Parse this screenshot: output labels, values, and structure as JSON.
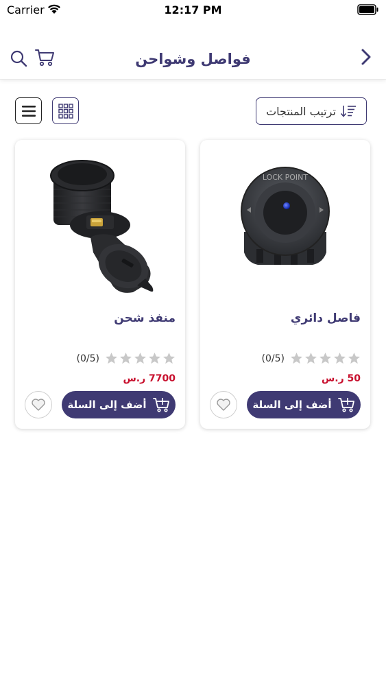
{
  "status_bar": {
    "carrier": "Carrier",
    "time": "12:17 PM"
  },
  "header": {
    "title": "فواصل وشواحن",
    "back_icon": "chevron-right-icon",
    "search_icon": "search-icon",
    "cart_icon": "cart-icon"
  },
  "toolbar": {
    "sort_label": "ترتيب المنتجات",
    "sort_icon": "sort-icon",
    "grid_icon": "grid-view-icon",
    "list_icon": "list-view-icon"
  },
  "colors": {
    "primary": "#3f3a73",
    "price": "#c8102e",
    "star_empty": "#c8c8c8"
  },
  "products": [
    {
      "name": "فاصل دائري",
      "rating": 0,
      "rating_count": "(0/5)",
      "price": "50 ر.س",
      "add_to_cart_label": "أضف إلى السلة",
      "image": "round-switch-image"
    },
    {
      "name": "منفذ شحن",
      "rating": 0,
      "rating_count": "(0/5)",
      "price": "7700 ر.س",
      "add_to_cart_label": "أضف إلى السلة",
      "image": "charging-port-image"
    }
  ]
}
